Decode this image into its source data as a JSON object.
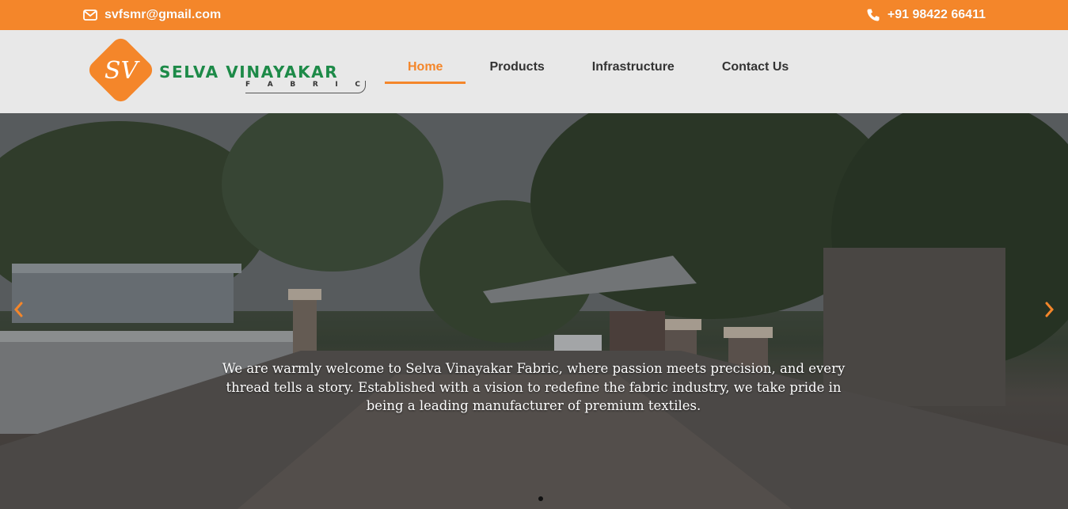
{
  "topbar": {
    "email": "svfsmr@gmail.com",
    "email_icon": "envelope-icon",
    "phone": "+91 98422 66411",
    "phone_icon": "phone-icon",
    "background": "#f4862a"
  },
  "logo": {
    "brand": "SELVA VINAYAKAR",
    "sub_letters": [
      "F",
      "A",
      "B",
      "R",
      "I",
      "C"
    ],
    "monogram": "SV",
    "brand_color": "#1d8a48",
    "accent": "#f4862a"
  },
  "nav": {
    "items": [
      {
        "label": "Home",
        "active": true
      },
      {
        "label": "Products",
        "active": false
      },
      {
        "label": "Infrastructure",
        "active": false
      },
      {
        "label": "Contact Us",
        "active": false
      }
    ]
  },
  "hero": {
    "caption": "We are warmly welcome to Selva Vinayakar Fabric, where passion meets precision, and every thread tells a story. Established with a vision to redefine the fabric industry, we take pride in being a leading manufacturer of premium textiles.",
    "prev_icon": "chevron-left-icon",
    "next_icon": "chevron-right-icon",
    "slide_count": 1,
    "active_slide": 1
  }
}
